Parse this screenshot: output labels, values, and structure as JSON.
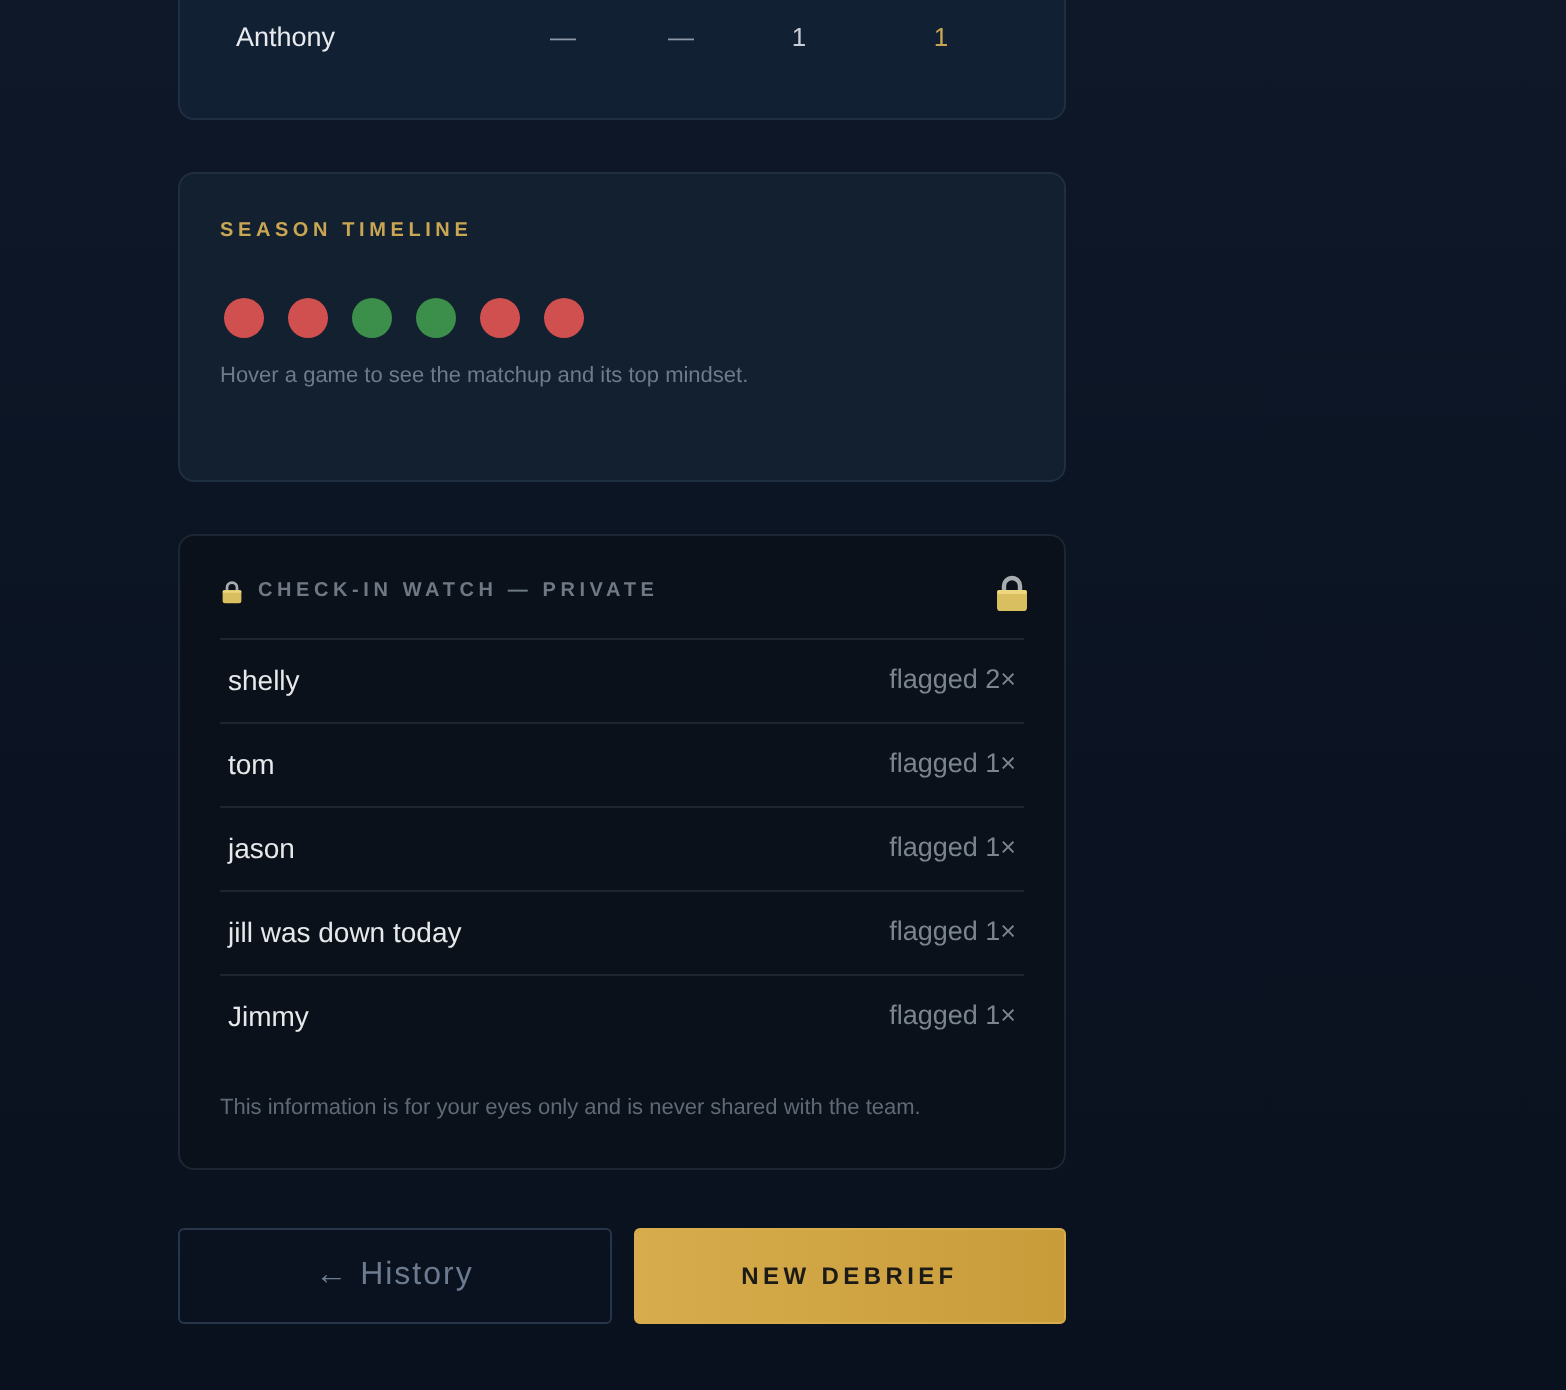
{
  "stats_table": {
    "rows": [
      {
        "column_1": "Anthony",
        "cells": [
          "—",
          "—",
          "1",
          "1"
        ]
      }
    ]
  },
  "season_timeline": {
    "title": "SEASON TIMELINE",
    "games": [
      {
        "color": "#d05050"
      },
      {
        "color": "#d05050"
      },
      {
        "color": "#3b8f4b"
      },
      {
        "color": "#3b8f4b"
      },
      {
        "color": "#d05050"
      },
      {
        "color": "#d05050"
      }
    ],
    "hint": "Hover a game to see the matchup and its top mindset."
  },
  "check_in_watch": {
    "title": "CHECK-IN WATCH — PRIVATE",
    "entries": [
      {
        "name": "shelly",
        "flags": "flagged 2×"
      },
      {
        "name": "tom",
        "flags": "flagged 1×"
      },
      {
        "name": "jason",
        "flags": "flagged 1×"
      },
      {
        "name": "jill was down today",
        "flags": "flagged 1×"
      },
      {
        "name": "Jimmy",
        "flags": "flagged 1×"
      }
    ],
    "footnote": "This information is for your eyes only and is never shared with the team."
  },
  "buttons": [
    {
      "kind": "secondary",
      "label": "← History"
    },
    {
      "kind": "primary",
      "label": "NEW DEBRIEF"
    }
  ]
}
